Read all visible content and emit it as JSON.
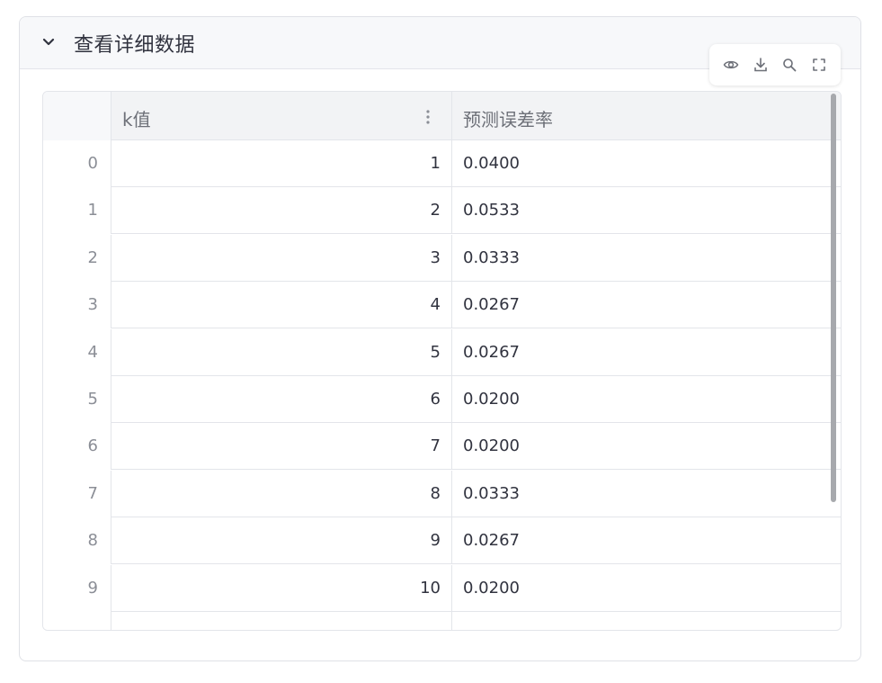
{
  "expander": {
    "title": "查看详细数据"
  },
  "toolbar": {
    "icons": [
      "eye-icon",
      "download-icon",
      "search-icon",
      "fullscreen-icon"
    ]
  },
  "table": {
    "columns": [
      "",
      "k值",
      "预测误差率"
    ],
    "rows": [
      {
        "index": "0",
        "k": "1",
        "rate": "0.0400"
      },
      {
        "index": "1",
        "k": "2",
        "rate": "0.0533"
      },
      {
        "index": "2",
        "k": "3",
        "rate": "0.0333"
      },
      {
        "index": "3",
        "k": "4",
        "rate": "0.0267"
      },
      {
        "index": "4",
        "k": "5",
        "rate": "0.0267"
      },
      {
        "index": "5",
        "k": "6",
        "rate": "0.0200"
      },
      {
        "index": "6",
        "k": "7",
        "rate": "0.0200"
      },
      {
        "index": "7",
        "k": "8",
        "rate": "0.0333"
      },
      {
        "index": "8",
        "k": "9",
        "rate": "0.0267"
      },
      {
        "index": "9",
        "k": "10",
        "rate": "0.0200"
      },
      {
        "index": "",
        "k": "",
        "rate": ""
      }
    ]
  },
  "colors": {
    "border": "#e3e5ea",
    "header_bg": "#f2f3f5",
    "text": "#31333f",
    "muted": "#8b8e96"
  }
}
